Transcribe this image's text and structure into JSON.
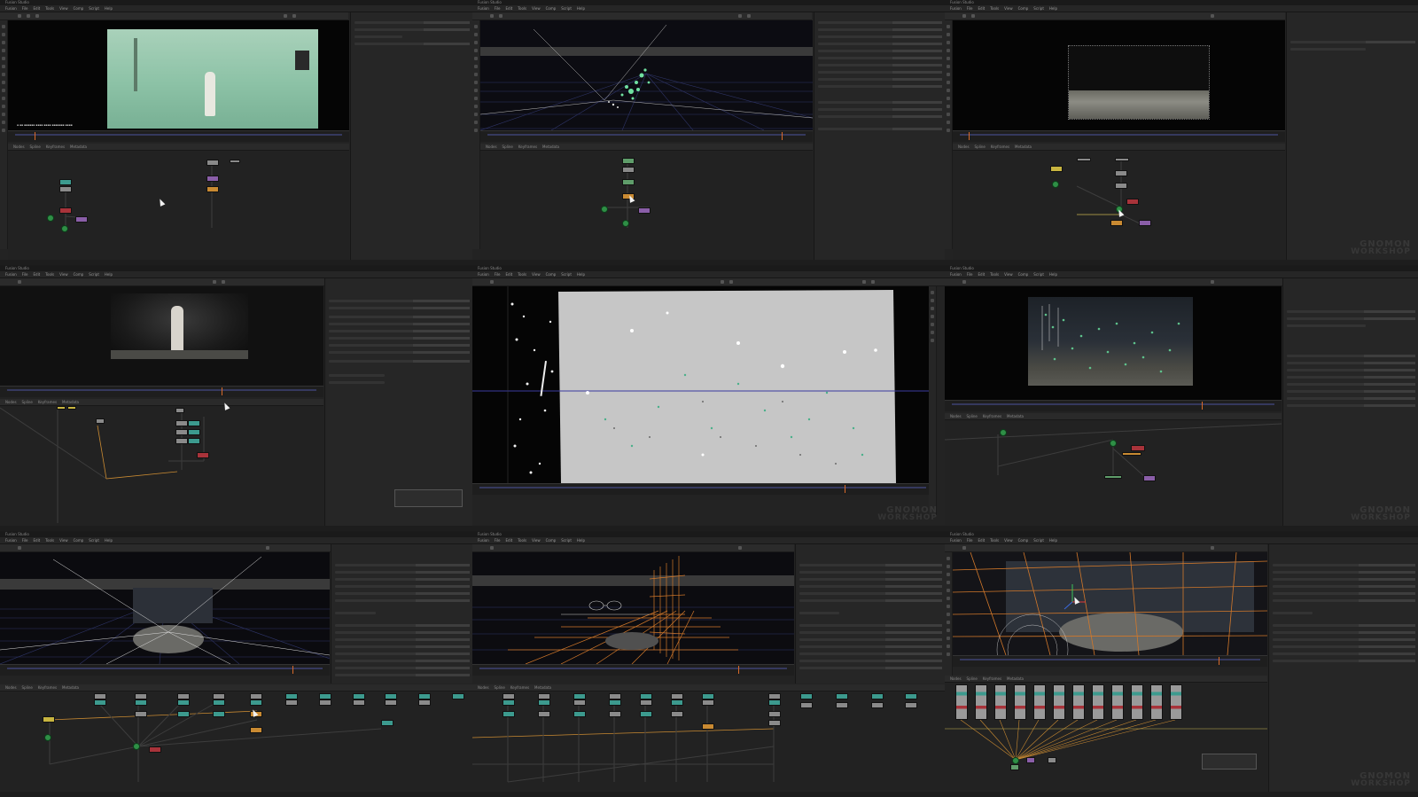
{
  "app": {
    "title": "Fusion Studio",
    "menu": [
      "Fusion",
      "File",
      "Edit",
      "Tools",
      "View",
      "Comp",
      "Script",
      "Help"
    ],
    "workspace_tabs": [
      "Nodes",
      "Spline",
      "Keyframes",
      "Metadata"
    ]
  },
  "watermark": {
    "line1": "GNOMON",
    "line2": "WORKSHOP"
  },
  "panels": [
    {
      "id": "p1",
      "viewer_content": "green-screen-footage-astronaut"
    },
    {
      "id": "p2",
      "viewer_content": "3d-point-cloud-track"
    },
    {
      "id": "p3",
      "viewer_content": "lunar-surface-plate"
    },
    {
      "id": "p4",
      "viewer_content": "astronaut-dark-plate"
    },
    {
      "id": "p5",
      "viewer_content": "tracking-matte-fullscreen"
    },
    {
      "id": "p6",
      "viewer_content": "tracked-points-overlay"
    },
    {
      "id": "p7",
      "viewer_content": "3d-scene-grid-ground"
    },
    {
      "id": "p8",
      "viewer_content": "3d-scene-orange-grid"
    },
    {
      "id": "p9",
      "viewer_content": "3d-scene-camera-projection"
    }
  ],
  "colors": {
    "node_green": "#5f9d6a",
    "node_teal": "#3c9a8e",
    "node_orange": "#c98a32",
    "node_purple": "#8a5ea8",
    "node_red": "#a8333a",
    "greenscreen": "#8fc4a8",
    "playhead": "#d86a2a",
    "grid_blue": "#35395e"
  }
}
